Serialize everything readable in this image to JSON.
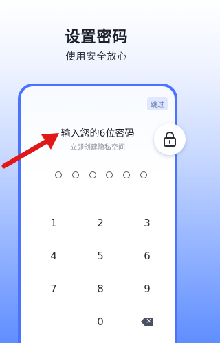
{
  "headline": "设置密码",
  "subline": "使用安全放心",
  "skip_label": "跳过",
  "pin": {
    "title": "输入您的6位密码",
    "hint": "立即创建隐私空间",
    "length": 6
  },
  "keypad": {
    "keys": [
      "1",
      "2",
      "3",
      "4",
      "5",
      "6",
      "7",
      "8",
      "9",
      "",
      "0",
      ""
    ]
  },
  "icons": {
    "lock": "lock-icon",
    "arrow": "red-arrow-icon",
    "backspace": "backspace-icon"
  },
  "colors": {
    "accent": "#4b73ff",
    "arrow": "#e01818"
  }
}
